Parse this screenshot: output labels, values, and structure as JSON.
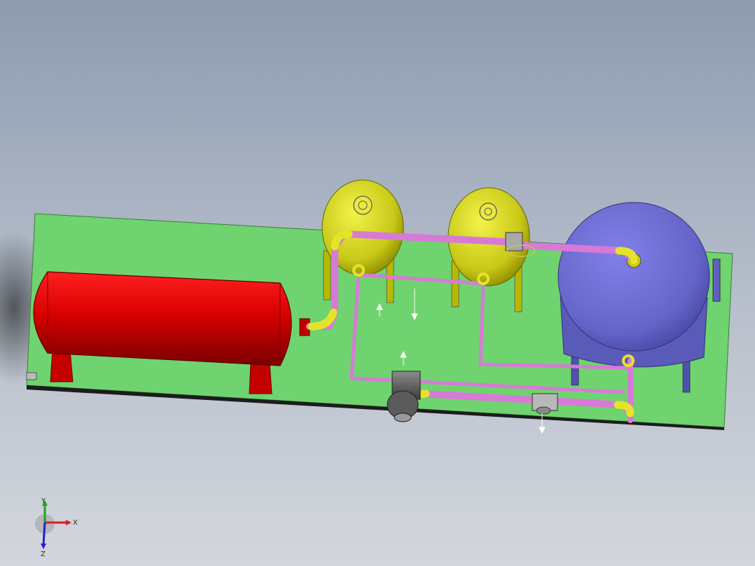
{
  "viewport": {
    "background_top": "#8d9bb0",
    "background_bottom": "#d3d6dc"
  },
  "model": {
    "base_plate_color": "#6fd36f",
    "horizontal_tank_color": "#e00000",
    "filter_tank_color": "#d4d41e",
    "large_tank_color": "#6f6fd0",
    "pipe_color": "#d77ad7",
    "elbow_color": "#e3e32a",
    "pump_color": "#6a6a6a"
  },
  "triad": {
    "x_label": "X",
    "y_label": "Y",
    "z_label": "Z",
    "x_color": "#d22020",
    "y_color": "#20a020",
    "z_color": "#2020d2"
  }
}
